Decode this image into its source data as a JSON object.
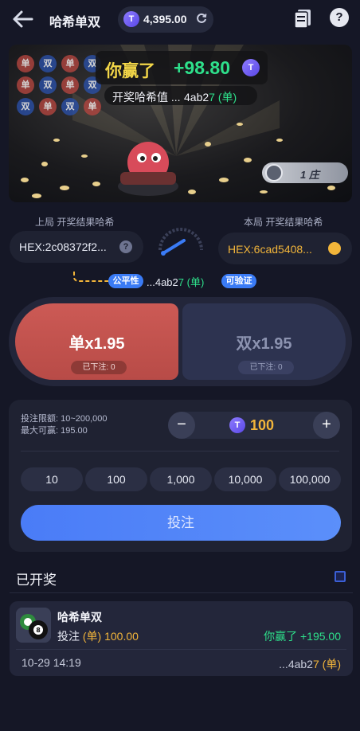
{
  "header": {
    "title": "哈希单双",
    "balance": "4,395.00",
    "coin_symbol": "T"
  },
  "banner": {
    "win_label": "你赢了",
    "win_amount": "+98.80",
    "hash_label": "开奖哈希值 ...",
    "hash_tail_prefix": "4ab2",
    "hash_tail_digit": "7",
    "hash_result": "(单)",
    "round_label": "1 庄",
    "grid_badges": [
      "单",
      "双",
      "单",
      "双",
      "单",
      "双",
      "单",
      "双",
      "单",
      "双",
      "单",
      "双"
    ]
  },
  "hash_section": {
    "prev_label": "上局 开奖结果哈希",
    "prev_value": "HEX:2c08372f2...",
    "current_label": "本局 开奖结果哈希",
    "current_value": "HEX:6cad5408...",
    "fair_tag": "公平性",
    "fair_hash_prefix": "...4ab2",
    "fair_hash_digit": "7",
    "fair_hash_result": "(单)",
    "verify_tag": "可验证"
  },
  "bets": {
    "odd_label": "单x1.95",
    "odd_stake": "已下注: 0",
    "even_label": "双x1.95",
    "even_stake": "已下注: 0"
  },
  "panel": {
    "limit_line": "投注限额: 10~200,000",
    "max_win_line": "最大可赢: 195.00",
    "stake_value": "100",
    "minus": "−",
    "plus": "+",
    "chips": [
      "10",
      "100",
      "1,000",
      "10,000",
      "100,000"
    ],
    "submit_label": "投注"
  },
  "history": {
    "title": "已开奖",
    "records": [
      {
        "game": "哈希单双",
        "bet_prefix": "投注",
        "bet_side": "(单)",
        "bet_amount": "100.00",
        "win_text": "你赢了 +195.00",
        "time": "10-29 14:19",
        "hash_prefix": "...4ab2",
        "hash_digit": "7",
        "hash_result": "(单)"
      }
    ]
  },
  "colors": {
    "accent_blue": "#4a7cf7",
    "win_green": "#2ee08b",
    "gold": "#f2b53a",
    "odd_red": "#cc5a55"
  }
}
